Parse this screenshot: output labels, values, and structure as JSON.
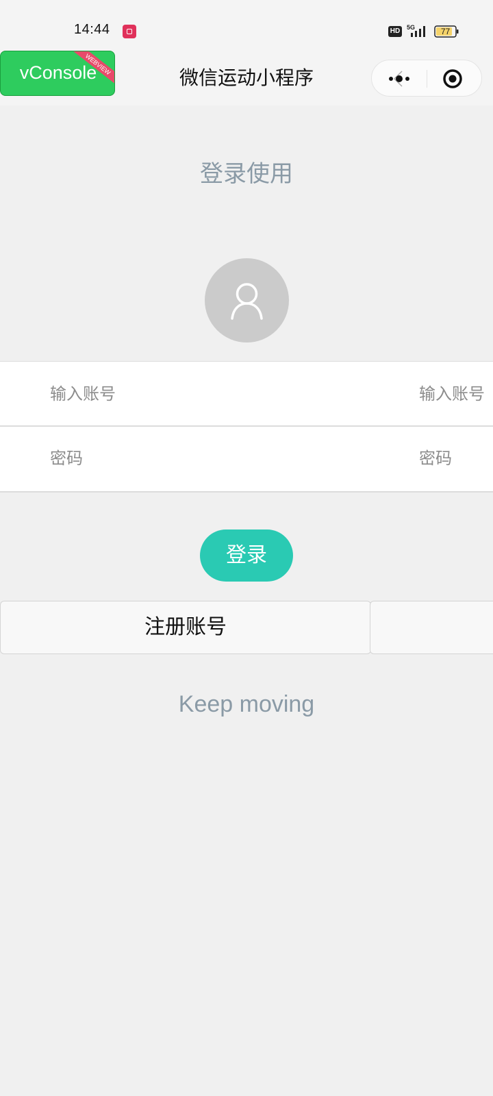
{
  "status_bar": {
    "time": "14:44",
    "hd_label": "HD",
    "network": "5G",
    "battery": "77"
  },
  "nav": {
    "vconsole_label": "vConsole",
    "webview_tag": "WEBVIEW",
    "title": "微信运动小程序",
    "more_icon": "more-dots-icon",
    "close_icon": "target-circle-icon"
  },
  "main": {
    "heading": "登录使用",
    "avatar_icon": "user-icon",
    "account_placeholder": "输入账号",
    "account_side_label": "输入账号",
    "password_placeholder": "密码",
    "password_side_label": "密码",
    "login_label": "登录",
    "register_label": "注册账号",
    "tagline": "Keep moving"
  },
  "colors": {
    "accent": "#2acab3",
    "vconsole_green": "#2ecc5e",
    "ribbon_red": "#e84a6a",
    "muted_text": "#8a9aa6",
    "page_bg": "#f0f0f0"
  }
}
